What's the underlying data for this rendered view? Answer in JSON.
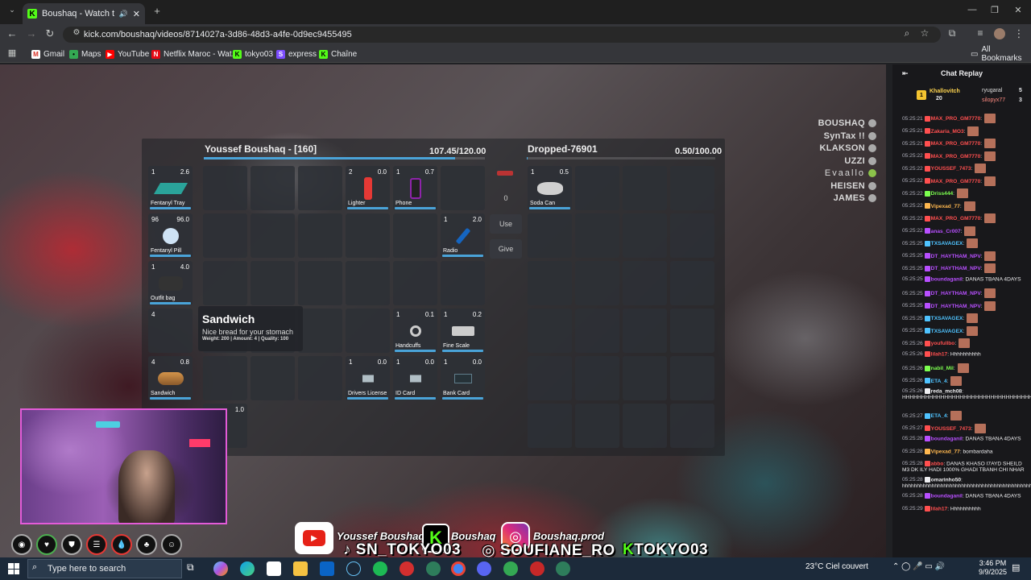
{
  "browser": {
    "tab_title": "Boushaq - Watch the VOD",
    "url": "kick.com/boushaq/videos/8714027a-3d86-48d3-a4fe-0d9ec9455495",
    "bookmarks": [
      "Gmail",
      "Maps",
      "YouTube",
      "Netflix Maroc - Wat...",
      "tokyo03",
      "express",
      "Chaîne"
    ],
    "all_bookmarks": "All Bookmarks"
  },
  "players": [
    "BOUSHAQ",
    "SynTax !!",
    "KLAKSON",
    "UZZI",
    "Evaallo",
    "HEISEN",
    "JAMES"
  ],
  "inventory": {
    "title": "Youssef Boushaq - [160]",
    "weight": "107.45/120.00",
    "weight_fraction": 0.895,
    "quick_slots": [
      {
        "count": "1",
        "weight": "2.6",
        "name": "Fentanyl Tray"
      },
      {
        "count": "96",
        "weight": "96.0",
        "name": "Fentanyl Pill"
      },
      {
        "count": "1",
        "weight": "4.0",
        "name": "Outfit bag"
      },
      {
        "count": "4",
        "weight": "",
        "name": ""
      },
      {
        "count": "4",
        "weight": "0.8",
        "name": "Sandwich"
      }
    ],
    "items": [
      {
        "slot": 3,
        "count": "2",
        "weight": "0.0",
        "name": "Lighter"
      },
      {
        "slot": 4,
        "count": "1",
        "weight": "0.7",
        "name": "Phone"
      },
      {
        "slot": 11,
        "count": "1",
        "weight": "2.0",
        "name": "Radio"
      },
      {
        "slot": 22,
        "count": "1",
        "weight": "0.1",
        "name": "Handcuffs"
      },
      {
        "slot": 23,
        "count": "1",
        "weight": "0.2",
        "name": "Fine Scale"
      },
      {
        "slot": 27,
        "count": "1",
        "weight": "0.0",
        "name": "Drivers License"
      },
      {
        "slot": 28,
        "count": "1",
        "weight": "0.0",
        "name": "ID Card"
      },
      {
        "slot": 29,
        "count": "1",
        "weight": "0.0",
        "name": "Bank Card"
      }
    ],
    "extra_slot_weight": "1.0",
    "amount": "0",
    "use_label": "Use",
    "give_label": "Give"
  },
  "dropped": {
    "title": "Dropped-76901",
    "weight": "0.50/100.00",
    "weight_fraction": 0.005,
    "items": [
      {
        "count": "1",
        "weight": "0.5",
        "name": "Soda Can"
      }
    ]
  },
  "tooltip": {
    "title": "Sandwich",
    "description": "Nice bread for your stomach",
    "meta": "Weight: 200 | Amount: 4 | Quality: 100"
  },
  "overlay": {
    "youtube": "Youssef Boushaq",
    "kick": "Boushaq",
    "instagram": "Boushaq.prod",
    "tiktok": "SN_TOKYO03",
    "insta2": "SOUFIANE_RO",
    "kick2": "TOKYO03"
  },
  "chat": {
    "header": "Chat Replay",
    "leaders": [
      {
        "name": "Khallovitch",
        "score": "20"
      },
      {
        "name": "ryugaral",
        "score": "5"
      },
      {
        "name": "silopyx77",
        "score": "3"
      }
    ],
    "messages": [
      {
        "ts": "05:25:21",
        "user": "MAX_PRO_GM7770",
        "color": "#ff4f4f",
        "text": ""
      },
      {
        "ts": "05:25:21",
        "user": "Zakaria_MO3",
        "color": "#ff4f4f",
        "text": ""
      },
      {
        "ts": "05:25:21",
        "user": "MAX_PRO_GM7770",
        "color": "#ff4f4f",
        "text": ""
      },
      {
        "ts": "05:25:22",
        "user": "MAX_PRO_GM7770",
        "color": "#ff4f4f",
        "text": ""
      },
      {
        "ts": "05:25:22",
        "user": "YOUSSEF_7473",
        "color": "#ff4f4f",
        "text": ""
      },
      {
        "ts": "05:25:22",
        "user": "MAX_PRO_GM7770",
        "color": "#ff4f4f",
        "text": ""
      },
      {
        "ts": "05:25:22",
        "user": "Driss444",
        "color": "#7cff4f",
        "text": ""
      },
      {
        "ts": "05:25:22",
        "user": "Vipexad_77",
        "color": "#ffb84f",
        "text": ""
      },
      {
        "ts": "05:25:22",
        "user": "MAX_PRO_GM7770",
        "color": "#ff4f4f",
        "text": ""
      },
      {
        "ts": "05:25:22",
        "user": "anas_Cr007",
        "color": "#b84fff",
        "text": ""
      },
      {
        "ts": "05:25:25",
        "user": "TXSAVAGEX",
        "color": "#4fc3ff",
        "text": ""
      },
      {
        "ts": "05:25:25",
        "user": "DT_HAYTHAM_NPV",
        "color": "#b84fff",
        "text": ""
      },
      {
        "ts": "05:25:25",
        "user": "DT_HAYTHAM_NPV",
        "color": "#b84fff",
        "text": ""
      },
      {
        "ts": "05:25:25",
        "user": "boundaganil",
        "color": "#b84fff",
        "text": "DANAS TBANA 4DAYS"
      },
      {
        "ts": "05:25:25",
        "user": "DT_HAYTHAM_NPV",
        "color": "#b84fff",
        "text": ""
      },
      {
        "ts": "05:25:25",
        "user": "DT_HAYTHAM_NPV",
        "color": "#b84fff",
        "text": ""
      },
      {
        "ts": "05:25:25",
        "user": "TXSAVAGEX",
        "color": "#4fc3ff",
        "text": ""
      },
      {
        "ts": "05:25:25",
        "user": "TXSAVAGEX",
        "color": "#4fc3ff",
        "text": ""
      },
      {
        "ts": "05:25:26",
        "user": "youfullbo",
        "color": "#ff4f4f",
        "text": ""
      },
      {
        "ts": "05:25:26",
        "user": "lilah17",
        "color": "#ff4f4f",
        "text": "Hhhhhhhhhh"
      },
      {
        "ts": "05:25:26",
        "user": "nabil_Mil",
        "color": "#7cff4f",
        "text": ""
      },
      {
        "ts": "05:25:26",
        "user": "ETA_4",
        "color": "#4fc3ff",
        "text": ""
      },
      {
        "ts": "05:25:26",
        "user": "reda_mch08",
        "color": "#efeff1",
        "text": "HHHHHHHHHHHHHHHHHHHHHHHHHHHHHHHHHHHHHHHHHHHHHHHHHHHHHHHHHHHHHHHHHHHH"
      },
      {
        "ts": "05:25:27",
        "user": "ETA_4",
        "color": "#4fc3ff",
        "text": ""
      },
      {
        "ts": "05:25:27",
        "user": "YOUSSEF_7473",
        "color": "#ff4f4f",
        "text": ""
      },
      {
        "ts": "05:25:28",
        "user": "boundaganil",
        "color": "#b84fff",
        "text": "DANAS TBANA 4DAYS"
      },
      {
        "ts": "05:25:28",
        "user": "Vipexad_77",
        "color": "#ffb84f",
        "text": "bombardaha"
      },
      {
        "ts": "05:25:28",
        "user": "abbo",
        "color": "#ff4f4f",
        "text": "DANAS KHASO I7AYD SHEILD M3 DK ILY HADI 1000% GHADI TBANH CHI NHAR"
      },
      {
        "ts": "05:25:28",
        "user": "omarinho50",
        "color": "#efeff1",
        "text": "hhhhhhhhhhhhhhhhhhhhhhhhhhhhhhhhhhhhhhhhhhhhhhhj"
      },
      {
        "ts": "05:25:28",
        "user": "boundaganil",
        "color": "#b84fff",
        "text": "DANAS TBANA 4DAYS"
      },
      {
        "ts": "05:25:29",
        "user": "lilah17",
        "color": "#ff4f4f",
        "text": "Hhhhhhhhhh"
      }
    ]
  },
  "taskbar": {
    "search_placeholder": "Type here to search",
    "weather": "23°C  Ciel couvert",
    "time": "3:46 PM",
    "date": "9/9/2025"
  }
}
